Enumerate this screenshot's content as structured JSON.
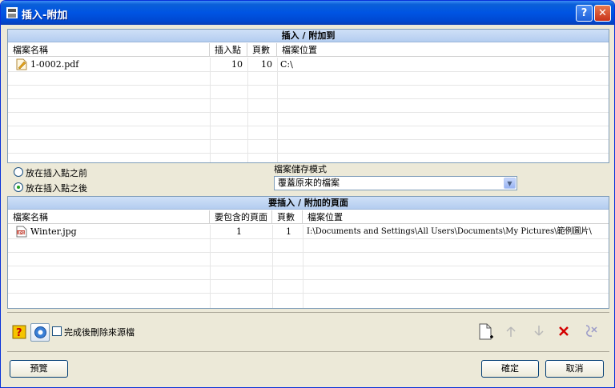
{
  "window": {
    "title": "插入-附加"
  },
  "titlebar_buttons": {
    "help": "?",
    "close": "✕"
  },
  "targets": {
    "header": "插入 / 附加到",
    "columns": [
      "檔案名稱",
      "插入點",
      "頁數",
      "檔案位置"
    ],
    "rows": [
      {
        "name": "1-0002.pdf",
        "insert_point": "10",
        "pages": "10",
        "location": "C:\\"
      }
    ]
  },
  "position": {
    "options": [
      "放在插入點之前",
      "放在插入點之後"
    ],
    "selected": "放在插入點之後"
  },
  "save_mode": {
    "label": "檔案儲存模式",
    "value": "覆蓋原來的檔案"
  },
  "sources": {
    "header": "要插入 / 附加的頁面",
    "columns": [
      "檔案名稱",
      "要包含的頁面",
      "頁數",
      "檔案位置"
    ],
    "rows": [
      {
        "name": "Winter.jpg",
        "pages_included": "1",
        "pages": "1",
        "location": "I:\\Documents and Settings\\All Users\\Documents\\My Pictures\\範例圖片\\"
      }
    ]
  },
  "footer": {
    "delete_after_label": "完成後刪除來源檔",
    "delete_after_checked": false,
    "preview": "預覽",
    "ok": "確定",
    "cancel": "取消"
  },
  "icons": {
    "help": "help-icon",
    "settings": "settings-icon",
    "add": "add-file-icon",
    "up": "move-up-icon",
    "down": "move-down-icon",
    "delete": "delete-icon",
    "clear": "clear-icon"
  },
  "colors": {
    "title_bar": "#0054e3",
    "panel_header": "#b4cdf0",
    "delete": "#d40000"
  }
}
